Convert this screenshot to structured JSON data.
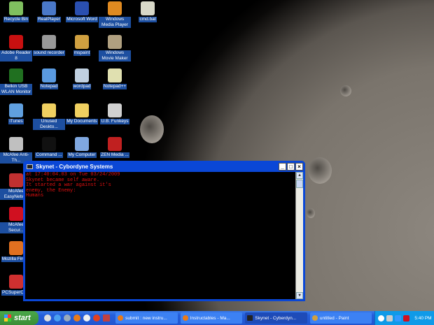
{
  "desktop": {
    "icons": [
      {
        "label": "Recycle Bin",
        "icon": "recycle-bin-icon",
        "color": "#7fbf5f"
      },
      {
        "label": "RealPlayer",
        "icon": "realplayer-icon",
        "color": "#4a78c8"
      },
      {
        "label": "Microsoft Word",
        "icon": "word-icon",
        "color": "#2a4fb0"
      },
      {
        "label": "Windows Media Player",
        "icon": "media-player-icon",
        "color": "#e08a20"
      },
      {
        "label": "cmd.bat",
        "icon": "batch-file-icon",
        "color": "#d8d8c8"
      },
      {
        "label": "Adobe Reader 8",
        "icon": "adobe-reader-icon",
        "color": "#c81010"
      },
      {
        "label": "sound recorder",
        "icon": "sound-recorder-icon",
        "color": "#999999"
      },
      {
        "label": "mspaint",
        "icon": "paint-icon",
        "color": "#d0a040"
      },
      {
        "label": "Windows Movie Maker",
        "icon": "movie-maker-icon",
        "color": "#b0a080"
      },
      {
        "label": "Belkin USB WLAN Monitor",
        "icon": "wlan-icon",
        "color": "#207020"
      },
      {
        "label": "Notepad",
        "icon": "notepad-icon",
        "color": "#5a9ae0"
      },
      {
        "label": "wordpad",
        "icon": "wordpad-icon",
        "color": "#c0d0e0"
      },
      {
        "label": "Notepad++",
        "icon": "notepad-plus-icon",
        "color": "#e0e0b0"
      },
      {
        "label": "iTunes",
        "icon": "itunes-icon",
        "color": "#60a0e0"
      },
      {
        "label": "Unused Deskto...",
        "icon": "folder-icon",
        "color": "#f0d060"
      },
      {
        "label": "My Documents",
        "icon": "folder-icon",
        "color": "#f0d060"
      },
      {
        "label": "U.B. Funkeys",
        "icon": "funkeys-icon",
        "color": "#d0d0d0"
      },
      {
        "label": "McAfee Anti-Th...",
        "icon": "mcafee-icon",
        "color": "#c0c0c0"
      },
      {
        "label": "Command ...",
        "icon": "command-prompt-icon",
        "color": "#111111"
      },
      {
        "label": "My Computer",
        "icon": "my-computer-icon",
        "color": "#80a8e0"
      },
      {
        "label": "ZEN Media ...",
        "icon": "zen-media-icon",
        "color": "#c02020"
      },
      {
        "label": "McAfee EasyNetw...",
        "icon": "mcafee-network-icon",
        "color": "#c03030"
      },
      {
        "label": "McAfee Secur...",
        "icon": "mcafee-security-icon",
        "color": "#d01020"
      },
      {
        "label": "Mozilla Firef...",
        "icon": "firefox-icon",
        "color": "#e07020"
      },
      {
        "label": "PCSuperCh...",
        "icon": "pcsupercharger-icon",
        "color": "#d03030"
      }
    ]
  },
  "window": {
    "title": "Skynet - Cybordyne Systems",
    "console_lines": [
      "at 17:40:04.03 on Tue 03/24/2009",
      "Skynet became self aware.",
      "It started a war against it's",
      "enemy, the Enemy:",
      "Humans"
    ],
    "text_color": "#e01010"
  },
  "taskbar": {
    "start_label": "start",
    "tasks": [
      {
        "label": "submit : new instru..."
      },
      {
        "label": "Instructables - Ma..."
      },
      {
        "label": "Skynet - Cyberdyn...",
        "active": true
      },
      {
        "label": "untitled - Paint"
      }
    ],
    "clock": "5:40 PM"
  }
}
